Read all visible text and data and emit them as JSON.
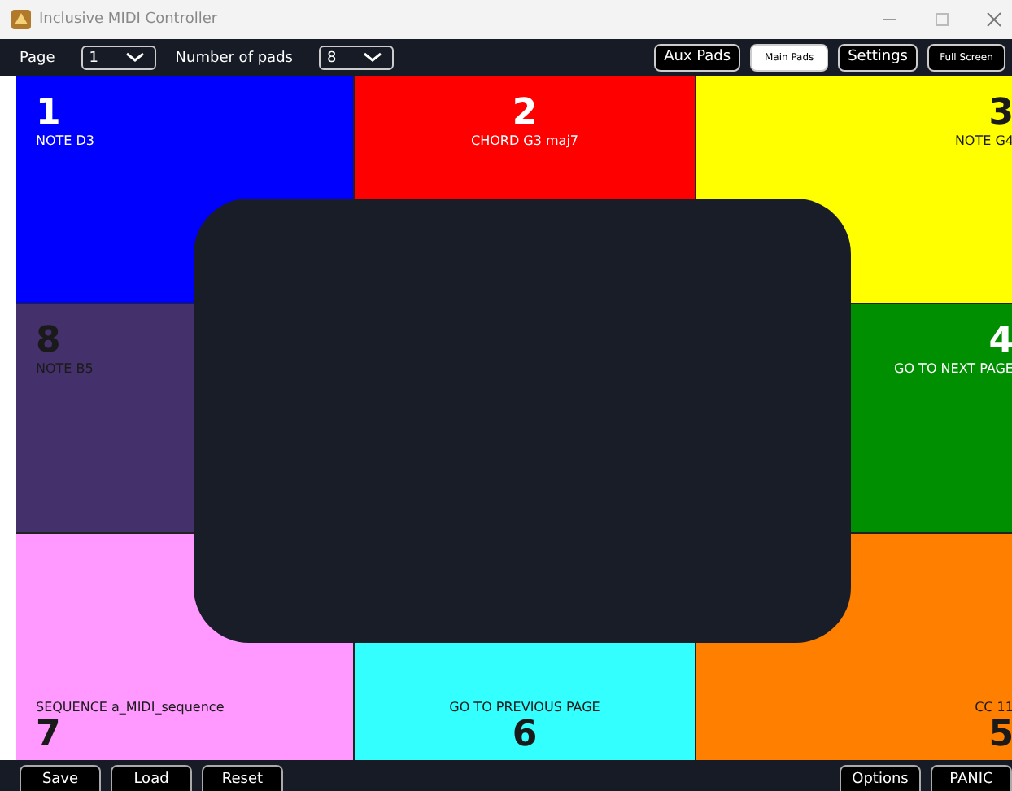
{
  "window": {
    "title": "Inclusive MIDI Controller"
  },
  "toolbar": {
    "page_label": "Page",
    "page_value": "1",
    "pads_label": "Number of pads",
    "pads_value": "8",
    "buttons": [
      {
        "label": "Aux Pads",
        "selected": false,
        "small": false
      },
      {
        "label": "Main Pads",
        "selected": true,
        "small": true
      },
      {
        "label": "Settings",
        "selected": false,
        "small": false
      },
      {
        "label": "Full Screen",
        "selected": false,
        "small": true
      }
    ]
  },
  "pads": [
    {
      "number": "1",
      "label": "NOTE D3",
      "color": "#0000ff",
      "dark_text": false
    },
    {
      "number": "2",
      "label": "CHORD G3 maj7",
      "color": "#ff0000",
      "dark_text": false
    },
    {
      "number": "3",
      "label": "NOTE G4",
      "color": "#ffff00",
      "dark_text": true
    },
    {
      "number": "8",
      "label": "NOTE B5",
      "color": "#44306a",
      "dark_text": true
    },
    {
      "number": "4",
      "label": "GO TO NEXT PAGE",
      "color": "#008f00",
      "dark_text": false
    },
    {
      "number": "7",
      "label": "SEQUENCE a_MIDI_sequence",
      "color": "#ff99ff",
      "dark_text": true
    },
    {
      "number": "6",
      "label": "GO TO PREVIOUS PAGE",
      "color": "#33ffff",
      "dark_text": true
    },
    {
      "number": "5",
      "label": "CC 11",
      "color": "#ff8000",
      "dark_text": true
    }
  ],
  "bottom_left": [
    "Save",
    "Load",
    "Reset"
  ],
  "bottom_right": [
    "Options",
    "PANIC"
  ]
}
